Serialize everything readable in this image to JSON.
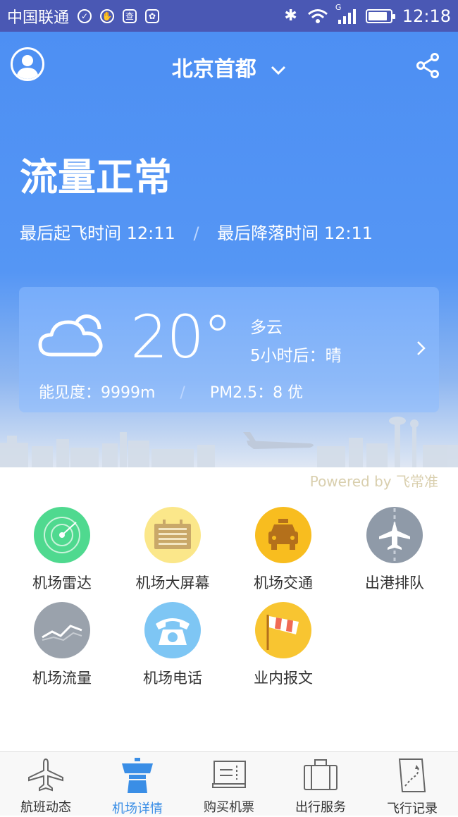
{
  "status_bar": {
    "carrier": "中国联通",
    "network": "G",
    "time": "12:18"
  },
  "header": {
    "city": "北京首都"
  },
  "flow": {
    "status": "流量正常",
    "last_departure_label": "最后起飞时间",
    "last_departure_time": "12:11",
    "separator": "/",
    "last_landing_label": "最后降落时间",
    "last_landing_time": "12:11"
  },
  "weather": {
    "temperature": "20°",
    "condition": "多云",
    "forecast": "5小时后：晴",
    "visibility": "能见度：9999m",
    "separator": "/",
    "pm25": "PM2.5：8 优"
  },
  "powered_by": "Powered by 飞常准",
  "services": [
    {
      "label": "机场雷达",
      "icon": "radar-icon",
      "color": "#4fd98f"
    },
    {
      "label": "机场大屏幕",
      "icon": "board-icon",
      "color": "#fbe78a"
    },
    {
      "label": "机场交通",
      "icon": "taxi-icon",
      "color": "#f8bd1f"
    },
    {
      "label": "出港排队",
      "icon": "plane-queue-icon",
      "color": "#8f9aa8"
    },
    {
      "label": "机场流量",
      "icon": "trend-icon",
      "color": "#9aa2ac"
    },
    {
      "label": "机场电话",
      "icon": "phone-icon",
      "color": "#7ec6f4"
    },
    {
      "label": "业内报文",
      "icon": "windsock-icon",
      "color": "#f8c531"
    }
  ],
  "tabs": [
    {
      "label": "航班动态",
      "icon": "plane-icon",
      "active": false
    },
    {
      "label": "机场详情",
      "icon": "tower-icon",
      "active": true
    },
    {
      "label": "购买机票",
      "icon": "ticket-icon",
      "active": false
    },
    {
      "label": "出行服务",
      "icon": "luggage-icon",
      "active": false
    },
    {
      "label": "飞行记录",
      "icon": "map-icon",
      "active": false
    }
  ],
  "colors": {
    "status_bar": "#4a58b4",
    "hero_top": "#4d8ff3",
    "tab_active": "#3a8ee6"
  }
}
